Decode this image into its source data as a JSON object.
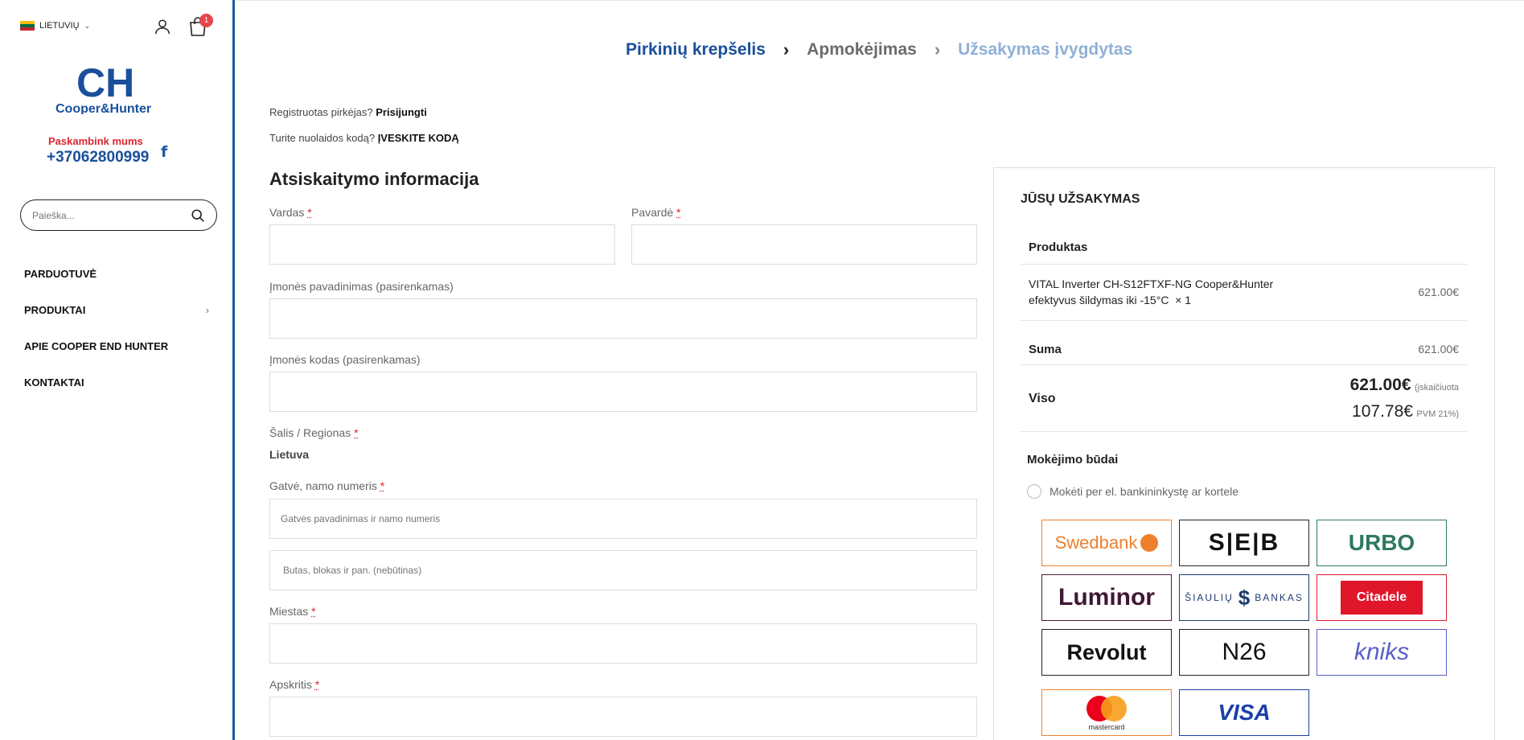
{
  "sidebar": {
    "language": "LIETUVIŲ",
    "cart_count": "1",
    "logo_letters": "CH",
    "logo_text": "Cooper&Hunter",
    "call_label": "Paskambink mums",
    "phone": "+37062800999",
    "search_placeholder": "Paieška...",
    "nav": [
      {
        "label": "PARDUOTUVĖ"
      },
      {
        "label": "PRODUKTAI",
        "has_submenu": true
      },
      {
        "label": "APIE COOPER END HUNTER"
      },
      {
        "label": "KONTAKTAI"
      }
    ]
  },
  "steps": {
    "step1": "Pirkinių krepšelis",
    "step2": "Apmokėjimas",
    "step3": "Užsakymas įvygdytas"
  },
  "notices": {
    "registered_prefix": "Registruotas pirkėjas?",
    "login_link": "Prisijungti",
    "discount_prefix": "Turite nuolaidos kodą?",
    "discount_link": "ĮVESKITE KODĄ"
  },
  "billing": {
    "title": "Atsiskaitymo informacija",
    "first_name_label": "Vardas",
    "last_name_label": "Pavardė",
    "company_label": "Įmonės pavadinimas (pasirenkamas)",
    "company_code_label": "Įmonės kodas (pasirenkamas)",
    "country_label": "Šalis / Regionas",
    "country_value": "Lietuva",
    "street_label": "Gatvė, namo numeris",
    "street_placeholder": "Gatvės pavadinimas ir namo numeris",
    "apt_placeholder": "Butas, blokas ir pan. (nebūtinas)",
    "city_label": "Miestas",
    "region_label": "Apskritis",
    "required_mark": "*"
  },
  "order": {
    "title": "JŪSŲ UŽSAKYMAS",
    "product_header": "Produktas",
    "product_name_line1": "VITAL Inverter CH-S12FTXF-NG Cooper&Hunter",
    "product_name_line2": "efektyvus šildymas iki -15°C",
    "product_qty": "× 1",
    "product_price": "621.00€",
    "subtotal_label": "Suma",
    "subtotal_value": "621.00€",
    "total_label": "Viso",
    "total_value": "621.00€",
    "total_note": "(įskaičiuota",
    "tax_value": "107.78€",
    "tax_note": "PVM 21%)",
    "payment_title": "Mokėjimo būdai",
    "payment_option": "Mokėti per el. bankininkystę ar kortele",
    "banks": {
      "swedbank": "Swedbank",
      "seb": "S|E|B",
      "urbo": "URBO",
      "luminor": "Luminor",
      "siauliu_left": "ŠIAULIŲ",
      "siauliu_right": "BANKAS",
      "citadele": "Citadele",
      "revolut": "Revolut",
      "n26": "N26",
      "kniks": "kniks",
      "mastercard": "mastercard",
      "visa": "VISA"
    }
  },
  "colors": {
    "brand_blue": "#1a4f9c",
    "brand_red": "#d9262e",
    "step_inactive": "#6b6b6b",
    "step_future": "#8fb0d6"
  }
}
